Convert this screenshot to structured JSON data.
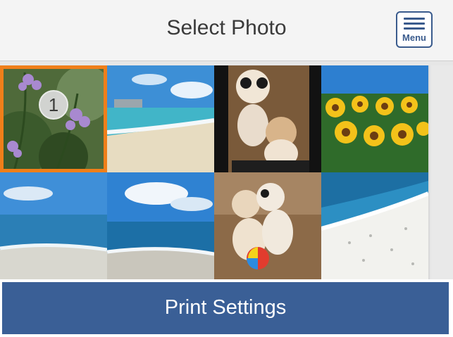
{
  "header": {
    "title": "Select Photo",
    "menu_label": "Menu"
  },
  "photos": [
    {
      "subject": "purple flowers",
      "selected": true,
      "selection_number": "1"
    },
    {
      "subject": "beach with city skyline",
      "selected": false
    },
    {
      "subject": "puppies on dark background",
      "selected": false
    },
    {
      "subject": "sunflower field",
      "selected": false
    },
    {
      "subject": "ocean beach",
      "selected": false
    },
    {
      "subject": "ocean with clouds",
      "selected": false
    },
    {
      "subject": "puppies with ball",
      "selected": false
    },
    {
      "subject": "white sand beach",
      "selected": false
    }
  ],
  "footer": {
    "print_settings_label": "Print Settings"
  },
  "colors": {
    "accent": "#ef7f1a",
    "button": "#3a5f96",
    "menu_icon": "#3a5b8d"
  }
}
